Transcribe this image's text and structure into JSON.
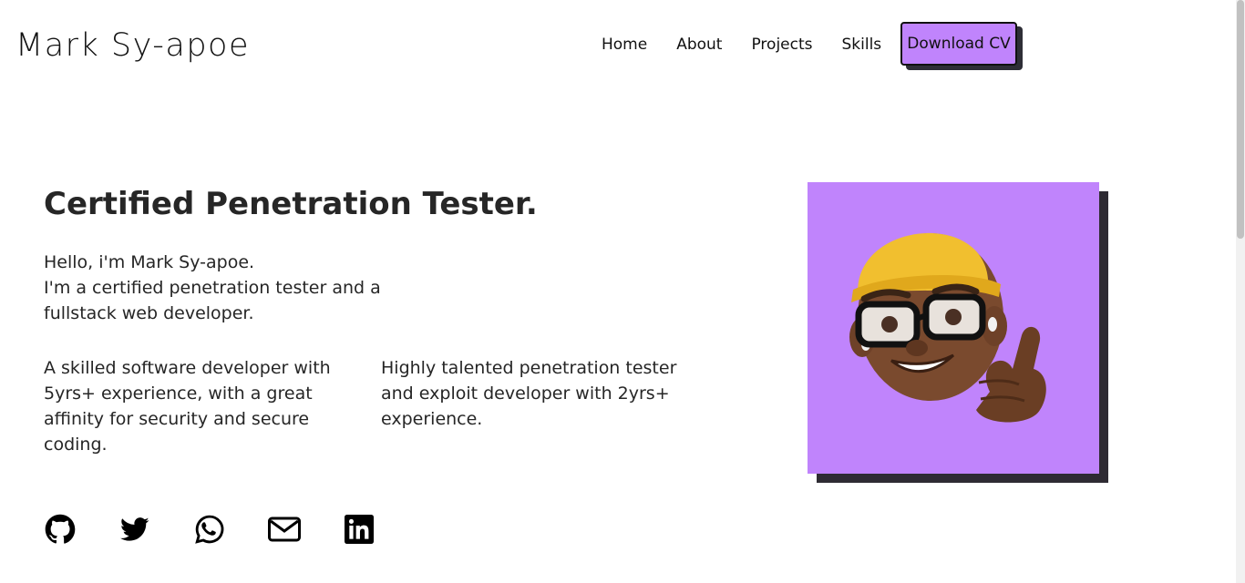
{
  "header": {
    "logo": "Mark Sy-apoe",
    "nav": [
      "Home",
      "About",
      "Projects",
      "Skills"
    ],
    "cta": "Download CV"
  },
  "hero": {
    "title": "Certified Penetration Tester.",
    "intro_line1": "Hello, i'm Mark Sy-apoe.",
    "intro_line2": "I'm a certified penetration tester and a fullstack web developer.",
    "col1": "A skilled software developer with 5yrs+ experience, with a great affinity for security and secure coding.",
    "col2": "Highly talented penetration tester and exploit developer with 2yrs+ experience."
  },
  "socials": [
    "github-icon",
    "twitter-icon",
    "whatsapp-icon",
    "mail-icon",
    "linkedin-icon"
  ],
  "colors": {
    "accent": "#c084fc",
    "shadow": "#2e2b33",
    "text": "#262626"
  }
}
